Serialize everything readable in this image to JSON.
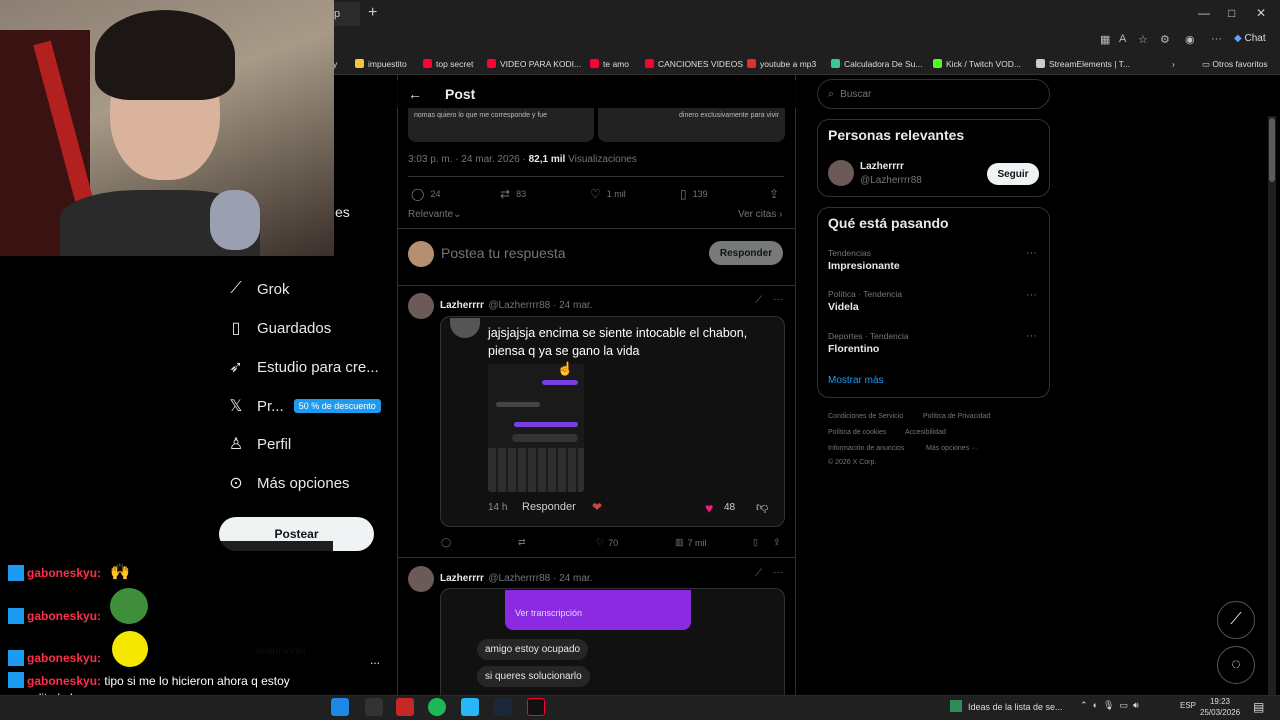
{
  "browser": {
    "tab_title": "p",
    "new_tab": "+",
    "window_controls": [
      "—",
      "□",
      "✕"
    ],
    "chat_label": "Chat",
    "bookmarks": [
      {
        "label": "y",
        "color": "#888888"
      },
      {
        "label": "impuestito",
        "color": "#f4c542"
      },
      {
        "label": "top secret",
        "color": "#ff0033"
      },
      {
        "label": "VIDEO PARA KODI...",
        "color": "#ff0033"
      },
      {
        "label": "te amo",
        "color": "#ff0033"
      },
      {
        "label": "CANCIONES VIDEOS",
        "color": "#ff0033"
      },
      {
        "label": "youtube a mp3",
        "color": "#e03030"
      },
      {
        "label": "Calculadora De Su...",
        "color": "#39c6a0"
      },
      {
        "label": "Kick / Twitch VOD...",
        "color": "#53fc18"
      },
      {
        "label": "StreamElements | T...",
        "color": "#cccccc"
      }
    ],
    "other_bookmarks": "Otros favoritos"
  },
  "sidebar": {
    "partial_label": "es",
    "items": [
      {
        "label": "Grok",
        "icon": "grok-icon"
      },
      {
        "label": "Guardados",
        "icon": "bookmark-icon"
      },
      {
        "label": "Estudio para cre...",
        "icon": "rocket-icon"
      },
      {
        "label": "Pr...",
        "icon": "x-logo-icon",
        "badge": "50 % de descuento"
      },
      {
        "label": "Perfil",
        "icon": "person-icon"
      },
      {
        "label": "Más opciones",
        "icon": "more-circle-icon"
      }
    ],
    "post_button": "Postear",
    "account_partial": "matumorell",
    "more": "..."
  },
  "post": {
    "header_title": "Post",
    "image_text_left": "nomas quiero lo que me corresponde y fue",
    "image_text_right": "dinero exclusivamente para vivir",
    "timestamp": "3:03 p. m. · 24 mar. 2026 ·",
    "views_count": "82,1 mil",
    "views_label": "Visualizaciones",
    "actions": {
      "replies": "24",
      "reposts": "83",
      "likes": "1 mil",
      "bookmarks": "139"
    },
    "relevance": "Relevante",
    "view_quotes": "Ver citas",
    "reply_placeholder": "Postea tu respuesta",
    "reply_button": "Responder"
  },
  "tweets": [
    {
      "name": "Lazherrrr",
      "handle": "@Lazherrrr88 · 24 mar.",
      "quote_text": "jajsjajsja encima se siente intocable el chabon, piensa q ya se gano la vida",
      "quote_time": "14 h",
      "quote_reply": "Responder",
      "quote_likes": "48",
      "actions": {
        "reposts": "",
        "likes": "70",
        "views": "7 mil"
      }
    },
    {
      "name": "Lazherrrr",
      "handle": "@Lazherrrr88 · 24 mar.",
      "transcription": "Ver transcripción",
      "messages": [
        "amigo estoy ocupado",
        "si queres solucionarlo"
      ]
    }
  ],
  "rightcol": {
    "search_placeholder": "Buscar",
    "relevant_title": "Personas relevantes",
    "relevant_name": "Lazherrrr",
    "relevant_handle": "@Lazherrrr88",
    "follow_button": "Seguir",
    "trends_title": "Qué está pasando",
    "trends": [
      {
        "category": "Tendencias",
        "name": "Impresionante"
      },
      {
        "category": "Política · Tendencia",
        "name": "Videla"
      },
      {
        "category": "Deportes · Tendencia",
        "name": "Florentino"
      }
    ],
    "show_more": "Mostrar más",
    "footer": [
      "Condiciones de Servicio",
      "Política de Privacidad",
      "Política de cookies",
      "Accesibilidad",
      "Información de anuncios",
      "Más opciones ···",
      "© 2026 X Corp."
    ]
  },
  "chat": {
    "lines": [
      {
        "user": "gaboneskyu:",
        "msg": ""
      },
      {
        "user": "gaboneskyu:",
        "msg": ""
      },
      {
        "user": "gaboneskyu:",
        "msg": ""
      }
    ],
    "last_user": "gaboneskyu:",
    "last_msg": "tipo si me lo hicieron ahora q estoy pegadito lo hago yo"
  },
  "taskbar": {
    "notification": "Ideas de la lista de se...",
    "language": "ESP",
    "time": "19:23",
    "date": "25/03/2026"
  }
}
